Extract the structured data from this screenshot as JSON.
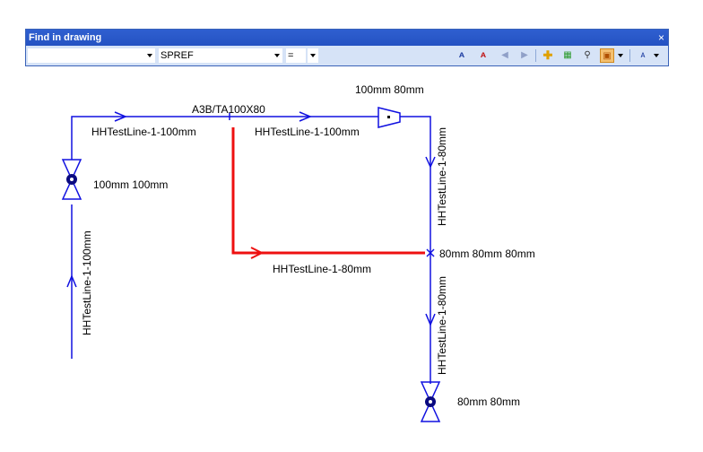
{
  "window": {
    "title": "Find in drawing",
    "close_glyph": "×"
  },
  "search": {
    "attribute_value": "SPREF",
    "operator_value": "="
  },
  "toolbar_icons": [
    "find-icon",
    "find-red-icon",
    "previous-icon",
    "next-icon",
    "add-icon",
    "select-all-icon",
    "zoom-icon",
    "highlight-icon",
    "options-icon"
  ],
  "drawing": {
    "line_color": "#1010e0",
    "highlight_color": "#ee1010",
    "labels": {
      "top_left_line": "HHTestLine-1-100mm",
      "top_mid_line": "HHTestLine-1-100mm",
      "tee_label": "A3B/TA100X80",
      "reducer_label": "100mm 80mm",
      "left_valve_label": "100mm 100mm",
      "left_vertical_line": "HHTestLine-1-100mm",
      "right_upper_vertical": "HHTestLine-1-80mm",
      "branch_line": "HHTestLine-1-80mm",
      "tee2_label": "80mm 80mm 80mm",
      "right_lower_vertical": "HHTestLine-1-80mm",
      "bottom_valve_label": "80mm 80mm"
    }
  }
}
